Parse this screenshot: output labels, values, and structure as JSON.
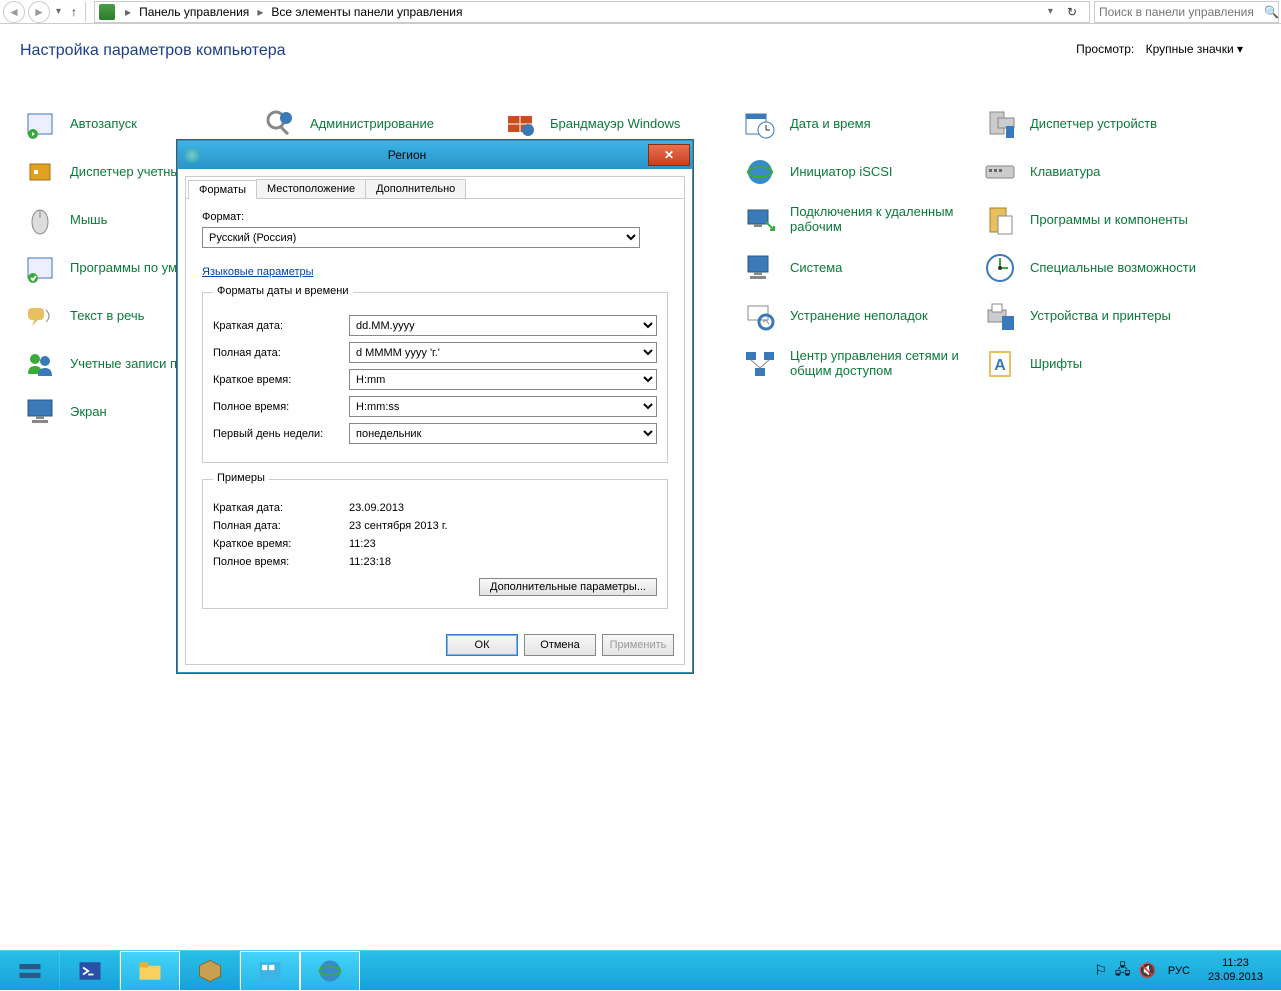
{
  "toolbar": {
    "breadcrumbs": [
      "Панель управления",
      "Все элементы панели управления"
    ],
    "search_placeholder": "Поиск в панели управления"
  },
  "main": {
    "heading": "Настройка параметров компьютера",
    "view_label": "Просмотр:",
    "view_value": "Крупные значки"
  },
  "items": [
    {
      "label": "Автозапуск"
    },
    {
      "label": "Администрирование"
    },
    {
      "label": "Брандмауэр Windows"
    },
    {
      "label": "Дата и время"
    },
    {
      "label": "Диспетчер устройств"
    },
    {
      "label": "Диспетчер учетных данных"
    },
    {
      "label": "Инициатор iSCSI"
    },
    {
      "label": "Клавиатура"
    },
    {
      "label": "Мышь"
    },
    {
      "label": "Подключения к удаленным рабочим"
    },
    {
      "label": "Программы и компоненты"
    },
    {
      "label": "Программы по умолчанию"
    },
    {
      "label": "Система"
    },
    {
      "label": "Специальные возможности"
    },
    {
      "label": "Текст в речь"
    },
    {
      "label": "Устранение неполадок"
    },
    {
      "label": "Устройства и принтеры"
    },
    {
      "label": "Учетные записи пользователей"
    },
    {
      "label": "Центр управления сетями и общим доступом"
    },
    {
      "label": "Шрифты"
    },
    {
      "label": "Экран"
    }
  ],
  "dialog": {
    "title": "Регион",
    "tabs": [
      "Форматы",
      "Местоположение",
      "Дополнительно"
    ],
    "format_label": "Формат:",
    "format_value": "Русский (Россия)",
    "lang_link": "Языковые параметры",
    "dt_group": "Форматы даты и времени",
    "rows": {
      "short_date_lbl": "Краткая дата:",
      "short_date_val": "dd.MM.yyyy",
      "long_date_lbl": "Полная дата:",
      "long_date_val": "d MMMM yyyy 'г.'",
      "short_time_lbl": "Краткое время:",
      "short_time_val": "H:mm",
      "long_time_lbl": "Полное время:",
      "long_time_val": "H:mm:ss",
      "first_day_lbl": "Первый день недели:",
      "first_day_val": "понедельник"
    },
    "examples_group": "Примеры",
    "examples": {
      "short_date_lbl": "Краткая дата:",
      "short_date_val": "23.09.2013",
      "long_date_lbl": "Полная дата:",
      "long_date_val": "23 сентября 2013 г.",
      "short_time_lbl": "Краткое время:",
      "short_time_val": "11:23",
      "long_time_lbl": "Полное время:",
      "long_time_val": "11:23:18"
    },
    "extra_btn": "Дополнительные параметры...",
    "ok": "ОК",
    "cancel": "Отмена",
    "apply": "Применить"
  },
  "taskbar": {
    "lang": "РУС",
    "time": "11:23",
    "date": "23.09.2013"
  }
}
